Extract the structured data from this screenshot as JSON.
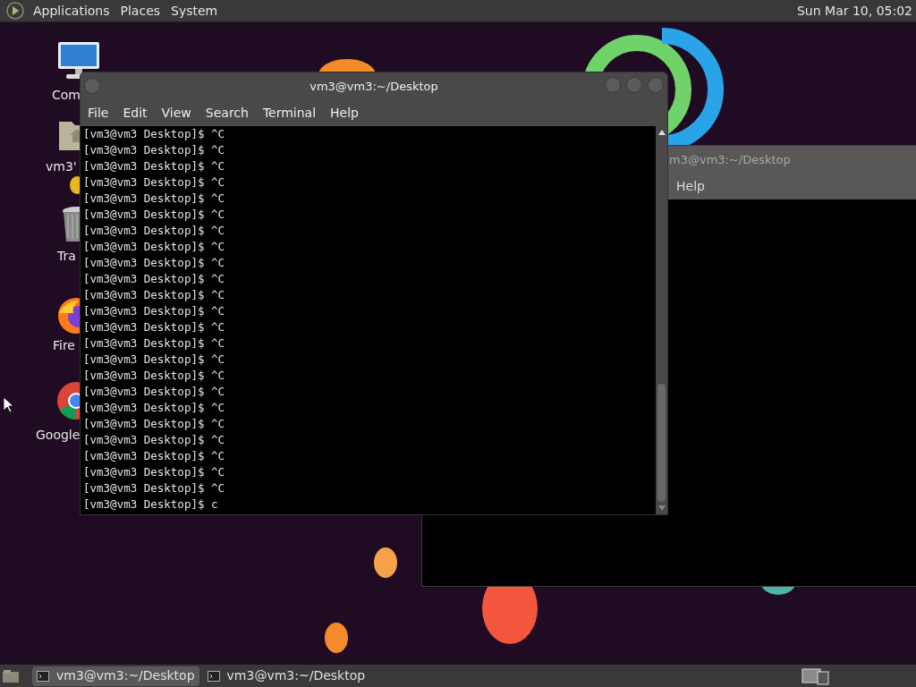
{
  "top_panel": {
    "menus": [
      "Applications",
      "Places",
      "System"
    ],
    "clock": "Sun Mar 10, 05:02"
  },
  "desktop_icons": [
    {
      "kind": "computer",
      "label": "Com"
    },
    {
      "kind": "home",
      "label": "vm3'"
    },
    {
      "kind": "trash",
      "label": "Tra"
    },
    {
      "kind": "firefox",
      "label": "Fire"
    },
    {
      "kind": "chrome",
      "label": "Google"
    }
  ],
  "windows": [
    {
      "title": "m3@vm3:~/Desktop",
      "active": false,
      "menus": [
        "Help"
      ]
    },
    {
      "title": "vm3@vm3:~/Desktop",
      "active": true,
      "menus": [
        "File",
        "Edit",
        "View",
        "Search",
        "Terminal",
        "Help"
      ],
      "lines": [
        "[vm3@vm3 Desktop]$ ^C",
        "[vm3@vm3 Desktop]$ ^C",
        "[vm3@vm3 Desktop]$ ^C",
        "[vm3@vm3 Desktop]$ ^C",
        "[vm3@vm3 Desktop]$ ^C",
        "[vm3@vm3 Desktop]$ ^C",
        "[vm3@vm3 Desktop]$ ^C",
        "[vm3@vm3 Desktop]$ ^C",
        "[vm3@vm3 Desktop]$ ^C",
        "[vm3@vm3 Desktop]$ ^C",
        "[vm3@vm3 Desktop]$ ^C",
        "[vm3@vm3 Desktop]$ ^C",
        "[vm3@vm3 Desktop]$ ^C",
        "[vm3@vm3 Desktop]$ ^C",
        "[vm3@vm3 Desktop]$ ^C",
        "[vm3@vm3 Desktop]$ ^C",
        "[vm3@vm3 Desktop]$ ^C",
        "[vm3@vm3 Desktop]$ ^C",
        "[vm3@vm3 Desktop]$ ^C",
        "[vm3@vm3 Desktop]$ ^C",
        "[vm3@vm3 Desktop]$ ^C",
        "[vm3@vm3 Desktop]$ ^C",
        "[vm3@vm3 Desktop]$ ^C",
        "[vm3@vm3 Desktop]$ c"
      ]
    }
  ],
  "taskbar": [
    {
      "label": "vm3@vm3:~/Desktop",
      "selected": true
    },
    {
      "label": "vm3@vm3:~/Desktop",
      "selected": false
    }
  ]
}
